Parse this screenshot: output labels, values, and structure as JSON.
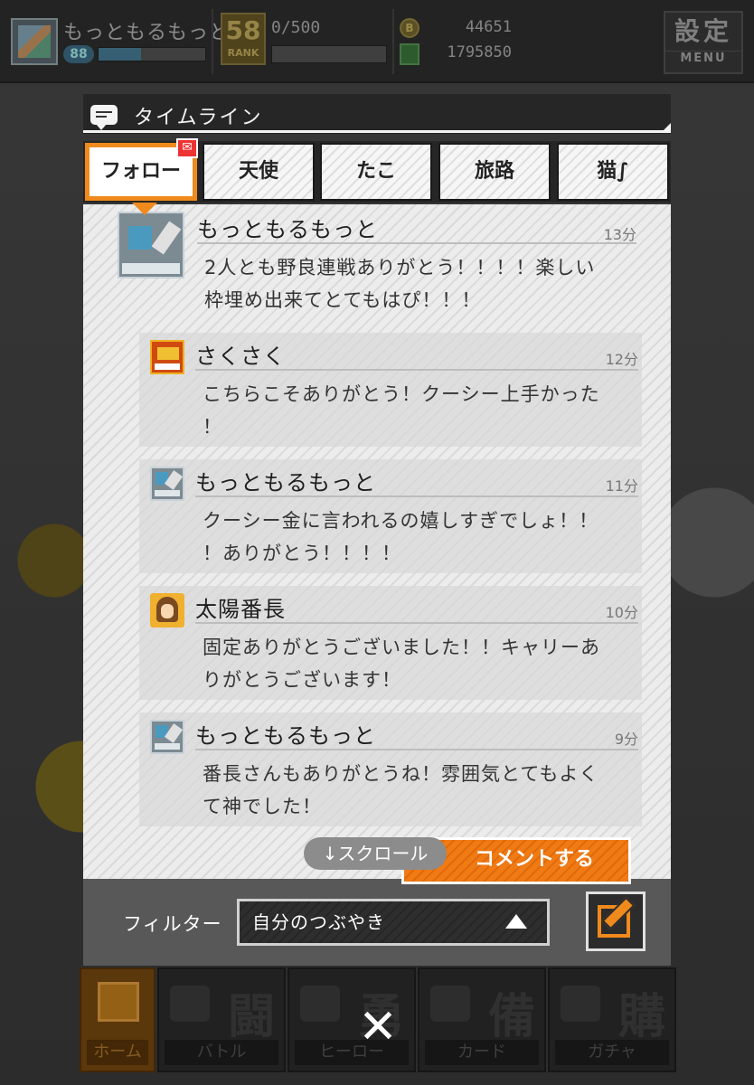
{
  "player": {
    "name": "もっともるもっと",
    "level": "88",
    "exp_fraction": 0.4
  },
  "rank": {
    "value": "58",
    "label": "RANK"
  },
  "stamina": {
    "text": "0/500",
    "fraction": 0.0
  },
  "currency": {
    "coins": "44651",
    "gems": "1795850",
    "coin_icon": "coin-icon",
    "gem_icon": "gem-icon"
  },
  "settings": {
    "kanji": "設定",
    "label": "MENU"
  },
  "timeline": {
    "title": "タイムライン",
    "tabs": [
      {
        "label": "フォロー",
        "active": true,
        "notify": "✉"
      },
      {
        "label": "天使",
        "active": false
      },
      {
        "label": "たこ",
        "active": false
      },
      {
        "label": "旅路",
        "active": false
      },
      {
        "label": "猫∫",
        "active": false
      }
    ],
    "posts": [
      {
        "author": "もっともるもっと",
        "time": "13分",
        "message": "2人とも野良連戦ありがとう！！！！楽しい\n枠埋め出来てとてもはぴ！！！",
        "avatar": "mok"
      },
      {
        "author": "さくさく",
        "time": "12分",
        "message": "こちらこそありがとう！クーシー上手かった\n！",
        "avatar": "saku"
      },
      {
        "author": "もっともるもっと",
        "time": "11分",
        "message": "クーシー金に言われるの嬉しすぎでしょ！！\n！ありがとう！！！！",
        "avatar": "mok"
      },
      {
        "author": "太陽番長",
        "time": "10分",
        "message": "固定ありがとうございました！！キャリーあ\nりがとうございます！",
        "avatar": "taiyo"
      },
      {
        "author": "もっともるもっと",
        "time": "9分",
        "message": "番長さんもありがとうね！雰囲気とてもよく\nて神でした！",
        "avatar": "mok"
      }
    ],
    "scroll_hint": "↓スクロール",
    "comment_button": "コメントする"
  },
  "filter": {
    "label": "フィルター",
    "selected": "自分のつぶやき"
  },
  "bottom_nav": [
    {
      "label": "ホーム",
      "kanji": "",
      "active": true
    },
    {
      "label": "バトル",
      "kanji": "闘"
    },
    {
      "label": "ヒーロー",
      "kanji": "勇"
    },
    {
      "label": "カード",
      "kanji": "備"
    },
    {
      "label": "ガチャ",
      "kanji": "購"
    }
  ],
  "close_symbol": "✕",
  "colors": {
    "accent_orange": "#f08a1c",
    "modal_dark": "#262626",
    "filter_bar": "#585858"
  }
}
